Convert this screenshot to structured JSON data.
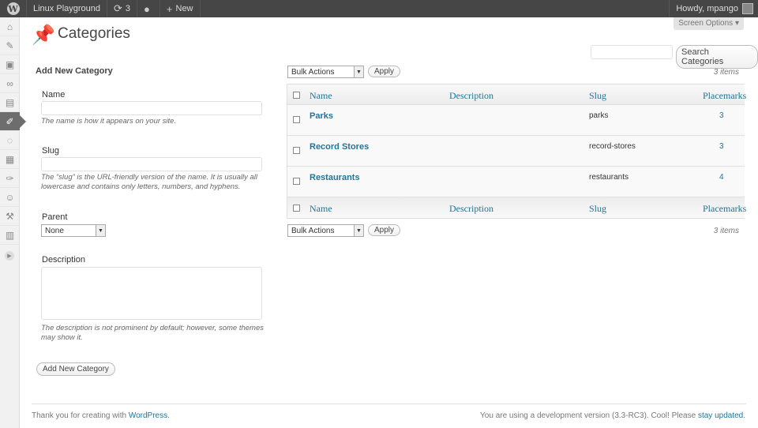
{
  "adminbar": {
    "site_name": "Linux Playground",
    "updates_count": "3",
    "new_label": "New",
    "howdy": "Howdy, mpango"
  },
  "sidebar": {
    "icons": [
      "dashboard-icon",
      "posts-icon",
      "media-icon",
      "links-icon",
      "pages-icon",
      "placemarks-icon",
      "comments-icon",
      "appearance-icon",
      "plugins-icon",
      "users-icon",
      "tools-icon",
      "settings-icon"
    ]
  },
  "header": {
    "screen_options": "Screen Options",
    "title": "Categories"
  },
  "search": {
    "button": "Search Categories"
  },
  "form": {
    "heading": "Add New Category",
    "name_label": "Name",
    "name_help": "The name is how it appears on your site.",
    "slug_label": "Slug",
    "slug_help": "The “slug” is the URL-friendly version of the name. It is usually all lowercase and contains only letters, numbers, and hyphens.",
    "parent_label": "Parent",
    "parent_value": "None",
    "description_label": "Description",
    "description_help": "The description is not prominent by default; however, some themes may show it.",
    "submit": "Add New Category"
  },
  "list": {
    "bulk_actions": "Bulk Actions",
    "apply": "Apply",
    "items_count": "3 items",
    "columns": [
      "Name",
      "Description",
      "Slug",
      "Placemarks"
    ],
    "rows": [
      {
        "name": "Parks",
        "slug": "parks",
        "count": "3"
      },
      {
        "name": "Record Stores",
        "slug": "record-stores",
        "count": "3"
      },
      {
        "name": "Restaurants",
        "slug": "restaurants",
        "count": "4"
      }
    ]
  },
  "footer": {
    "left_text": "Thank you for creating with ",
    "left_link": "WordPress",
    "left_end": ".",
    "right_text": "You are using a development version (3.3-RC3). Cool! Please ",
    "right_link": "stay updated",
    "right_end": "."
  }
}
